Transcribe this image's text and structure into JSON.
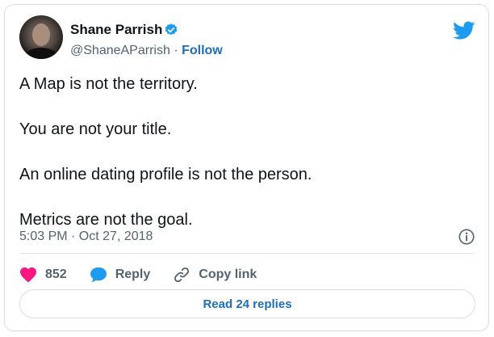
{
  "author": {
    "name": "Shane Parrish",
    "handle": "@ShaneAParrish",
    "separator": "·",
    "follow_label": "Follow",
    "verified": true
  },
  "tweet": {
    "lines": [
      "A Map is not the territory.",
      "You are not your title.",
      "An online dating profile is not the person.",
      "Metrics are not the goal."
    ],
    "timestamp": "5:03 PM · Oct 27, 2018"
  },
  "actions": {
    "likes_count": "852",
    "reply_label": "Reply",
    "copy_link_label": "Copy link"
  },
  "read_replies_label": "Read 24 replies",
  "icons": {
    "twitter_bird": "twitter-bird-icon",
    "verified": "verified-badge-icon",
    "info": "info-icon",
    "like": "heart-icon",
    "reply": "speech-bubble-icon",
    "copy_link": "link-icon"
  },
  "colors": {
    "twitter_blue": "#1d9bf0",
    "link_blue": "#1d6fb8",
    "like_pink": "#f91880",
    "text_primary": "#0f1419",
    "text_secondary": "#536471"
  }
}
